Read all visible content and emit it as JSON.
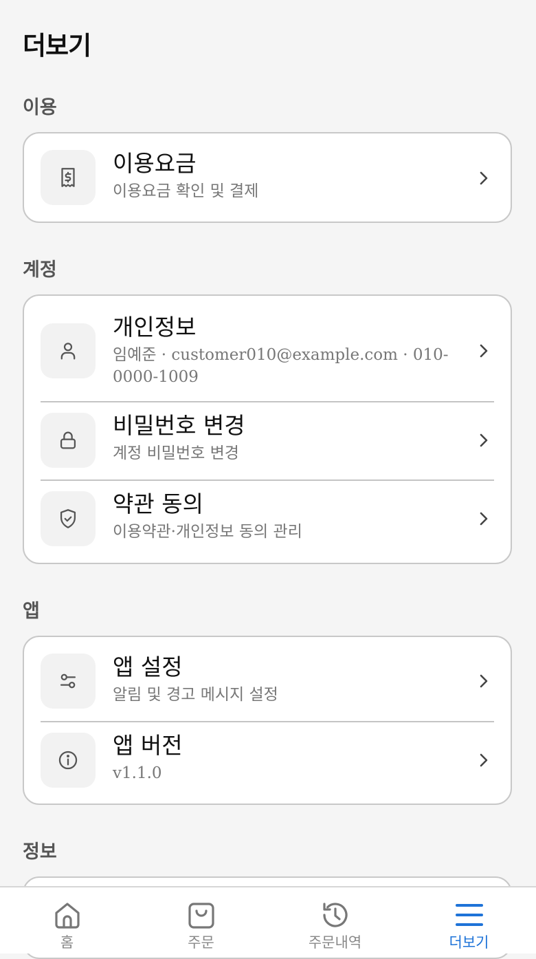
{
  "page": {
    "title": "더보기"
  },
  "sections": {
    "usage": {
      "title": "이용",
      "items": [
        {
          "title": "이용요금",
          "subtitle": "이용요금 확인 및 결제",
          "icon": "receipt-dollar-icon"
        }
      ]
    },
    "account": {
      "title": "계정",
      "items": [
        {
          "title": "개인정보",
          "subtitle": "임예준 · customer010@example.com · 010-0000-1009",
          "icon": "user-icon"
        },
        {
          "title": "비밀번호 변경",
          "subtitle": "계정 비밀번호 변경",
          "icon": "lock-icon"
        },
        {
          "title": "약관 동의",
          "subtitle": "이용약관·개인정보 동의 관리",
          "icon": "shield-check-icon"
        }
      ]
    },
    "app": {
      "title": "앱",
      "items": [
        {
          "title": "앱 설정",
          "subtitle": "알림 및 경고 메시지 설정",
          "icon": "sliders-icon"
        },
        {
          "title": "앱 버전",
          "subtitle": "v1.1.0",
          "icon": "info-icon"
        }
      ]
    },
    "info": {
      "title": "정보"
    }
  },
  "bottom_nav": {
    "items": [
      {
        "label": "홈",
        "icon": "home-icon"
      },
      {
        "label": "주문",
        "icon": "shopping-bag-icon"
      },
      {
        "label": "주문내역",
        "icon": "history-icon"
      },
      {
        "label": "더보기",
        "icon": "menu-icon",
        "active": true
      }
    ]
  },
  "colors": {
    "accent": "#1e73d8",
    "background": "#f5f5f5"
  }
}
